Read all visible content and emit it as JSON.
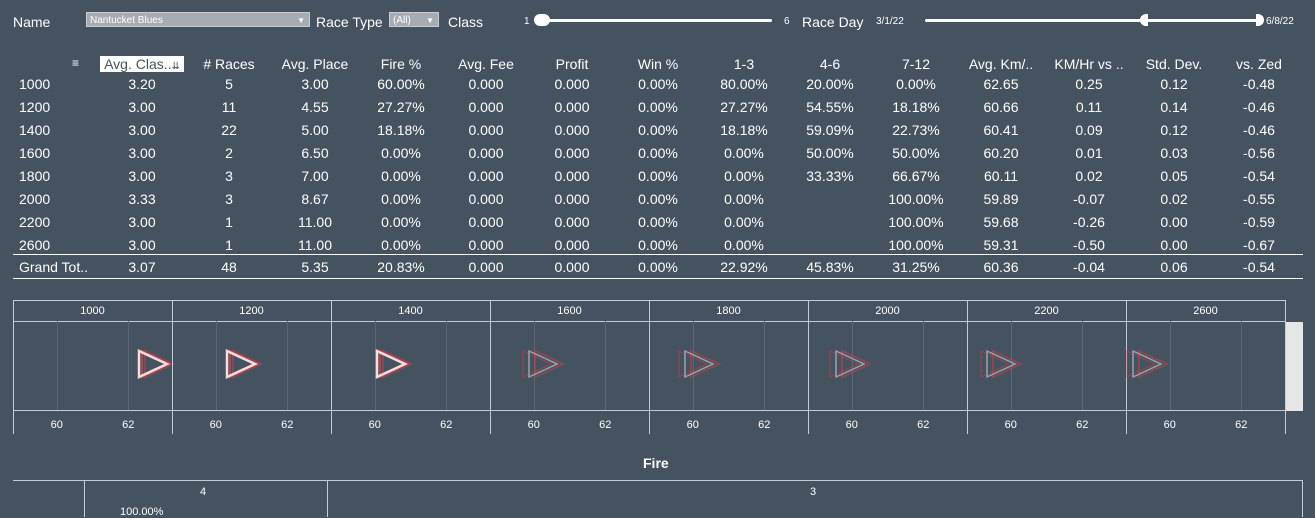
{
  "filters": {
    "name_label": "Name",
    "name_value": "Nantucket Blues",
    "race_type_label": "Race Type",
    "race_type_value": "(All)",
    "class_label": "Class",
    "class_min": "1",
    "class_max": "6",
    "race_day_label": "Race Day",
    "race_day_start": "3/1/22",
    "race_day_end": "6/8/22"
  },
  "table": {
    "headers": [
      "Avg. Clas..",
      "# Races",
      "Avg. Place",
      "Fire %",
      "Avg. Fee",
      "Profit",
      "Win %",
      "1-3",
      "4-6",
      "7-12",
      "Avg. Km/..",
      "KM/Hr vs ..",
      "Std. Dev.",
      "vs. Zed"
    ],
    "rows": [
      {
        "label": "1000",
        "cells": [
          "3.20",
          "5",
          "3.00",
          "60.00%",
          "0.000",
          "0.000",
          "0.00%",
          "80.00%",
          "20.00%",
          "0.00%",
          "62.65",
          "0.25",
          "0.12",
          "-0.48"
        ]
      },
      {
        "label": "1200",
        "cells": [
          "3.00",
          "11",
          "4.55",
          "27.27%",
          "0.000",
          "0.000",
          "0.00%",
          "27.27%",
          "54.55%",
          "18.18%",
          "60.66",
          "0.11",
          "0.14",
          "-0.46"
        ]
      },
      {
        "label": "1400",
        "cells": [
          "3.00",
          "22",
          "5.00",
          "18.18%",
          "0.000",
          "0.000",
          "0.00%",
          "18.18%",
          "59.09%",
          "22.73%",
          "60.41",
          "0.09",
          "0.12",
          "-0.46"
        ]
      },
      {
        "label": "1600",
        "cells": [
          "3.00",
          "2",
          "6.50",
          "0.00%",
          "0.000",
          "0.000",
          "0.00%",
          "0.00%",
          "50.00%",
          "50.00%",
          "60.20",
          "0.01",
          "0.03",
          "-0.56"
        ]
      },
      {
        "label": "1800",
        "cells": [
          "3.00",
          "3",
          "7.00",
          "0.00%",
          "0.000",
          "0.000",
          "0.00%",
          "0.00%",
          "33.33%",
          "66.67%",
          "60.11",
          "0.02",
          "0.05",
          "-0.54"
        ]
      },
      {
        "label": "2000",
        "cells": [
          "3.33",
          "3",
          "8.67",
          "0.00%",
          "0.000",
          "0.000",
          "0.00%",
          "0.00%",
          "",
          "100.00%",
          "59.89",
          "-0.07",
          "0.02",
          "-0.55"
        ]
      },
      {
        "label": "2200",
        "cells": [
          "3.00",
          "1",
          "11.00",
          "0.00%",
          "0.000",
          "0.000",
          "0.00%",
          "0.00%",
          "",
          "100.00%",
          "59.68",
          "-0.26",
          "0.00",
          "-0.59"
        ]
      },
      {
        "label": "2600",
        "cells": [
          "3.00",
          "1",
          "11.00",
          "0.00%",
          "0.000",
          "0.000",
          "0.00%",
          "0.00%",
          "",
          "100.00%",
          "59.31",
          "-0.50",
          "0.00",
          "-0.67"
        ]
      }
    ],
    "total": {
      "label": "Grand Tot..",
      "cells": [
        "3.07",
        "48",
        "5.35",
        "20.83%",
        "0.000",
        "0.000",
        "0.00%",
        "22.92%",
        "45.83%",
        "31.25%",
        "60.36",
        "-0.04",
        "0.06",
        "-0.54"
      ]
    }
  },
  "chart_data": {
    "type": "scatter",
    "panels": [
      "1000",
      "1200",
      "1400",
      "1600",
      "1800",
      "2000",
      "2200",
      "2600"
    ],
    "x_ticks": [
      "60",
      "62"
    ],
    "xlim": [
      59,
      63
    ],
    "values": [
      62.65,
      60.66,
      60.41,
      60.2,
      60.11,
      59.89,
      59.68,
      59.31
    ]
  },
  "fire": {
    "title": "Fire",
    "columns": [
      "4",
      "3"
    ],
    "first_value": "100.00%"
  },
  "colors": {
    "background": "#45525f",
    "marker_light": "#f2dede",
    "marker_red": "#c0404a",
    "marker_grey": "#9aa3ad"
  }
}
